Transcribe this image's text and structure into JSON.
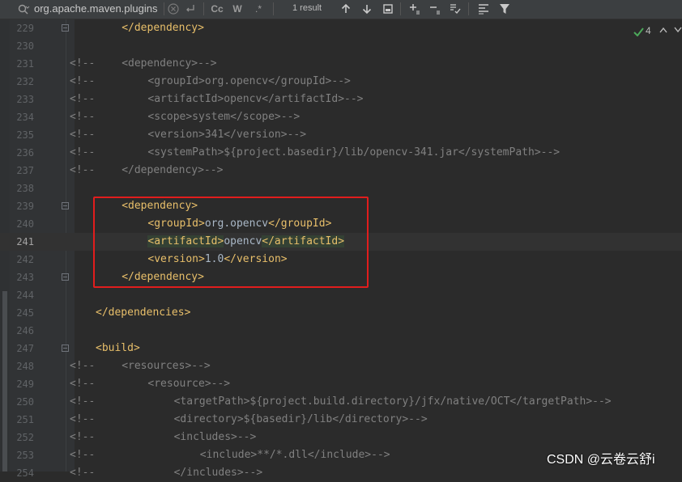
{
  "search": {
    "query": "org.apache.maven.plugins",
    "match_case_label": "Cc",
    "whole_word_label": "W",
    "regex_label": ".*",
    "result_count": "1 result"
  },
  "inspections": {
    "count": "4"
  },
  "editor": {
    "lines": [
      {
        "n": "229",
        "indent": 8,
        "kind": "tag",
        "text": "</dependency>"
      },
      {
        "n": "230",
        "indent": 0,
        "kind": "empty",
        "text": ""
      },
      {
        "n": "231",
        "indent": 0,
        "kind": "comment",
        "prefix": "<!--",
        "pad": 8,
        "text": "<dependency>-->"
      },
      {
        "n": "232",
        "indent": 0,
        "kind": "comment",
        "prefix": "<!--",
        "pad": 12,
        "text": "<groupId>org.opencv</groupId>-->"
      },
      {
        "n": "233",
        "indent": 0,
        "kind": "comment",
        "prefix": "<!--",
        "pad": 12,
        "text": "<artifactId>opencv</artifactId>-->"
      },
      {
        "n": "234",
        "indent": 0,
        "kind": "comment",
        "prefix": "<!--",
        "pad": 12,
        "text": "<scope>system</scope>-->"
      },
      {
        "n": "235",
        "indent": 0,
        "kind": "comment",
        "prefix": "<!--",
        "pad": 12,
        "text": "<version>341</version>-->"
      },
      {
        "n": "236",
        "indent": 0,
        "kind": "comment",
        "prefix": "<!--",
        "pad": 12,
        "text": "<systemPath>${project.basedir}/lib/opencv-341.jar</systemPath>-->"
      },
      {
        "n": "237",
        "indent": 0,
        "kind": "comment",
        "prefix": "<!--",
        "pad": 8,
        "text": "</dependency>-->"
      },
      {
        "n": "238",
        "indent": 0,
        "kind": "empty",
        "text": ""
      },
      {
        "n": "239",
        "indent": 8,
        "kind": "tag",
        "text": "<dependency>"
      },
      {
        "n": "240",
        "indent": 12,
        "kind": "mixed",
        "open": "<groupId>",
        "value": "org.opencv",
        "close": "</groupId>"
      },
      {
        "n": "241",
        "indent": 12,
        "kind": "mixed-hl",
        "open": "<artifactId>",
        "value": "opencv",
        "close": "</artifactId>"
      },
      {
        "n": "242",
        "indent": 12,
        "kind": "mixed",
        "open": "<version>",
        "value": "1.0",
        "close": "</version>"
      },
      {
        "n": "243",
        "indent": 8,
        "kind": "tag",
        "text": "</dependency>"
      },
      {
        "n": "244",
        "indent": 0,
        "kind": "empty",
        "text": ""
      },
      {
        "n": "245",
        "indent": 4,
        "kind": "tag",
        "text": "</dependencies>"
      },
      {
        "n": "246",
        "indent": 0,
        "kind": "empty",
        "text": ""
      },
      {
        "n": "247",
        "indent": 4,
        "kind": "tag",
        "text": "<build>"
      },
      {
        "n": "248",
        "indent": 0,
        "kind": "comment",
        "prefix": "<!--",
        "pad": 8,
        "text": "<resources>-->"
      },
      {
        "n": "249",
        "indent": 0,
        "kind": "comment",
        "prefix": "<!--",
        "pad": 12,
        "text": "<resource>-->"
      },
      {
        "n": "250",
        "indent": 0,
        "kind": "comment",
        "prefix": "<!--",
        "pad": 16,
        "text": "<targetPath>${project.build.directory}/jfx/native/OCT</targetPath>-->"
      },
      {
        "n": "251",
        "indent": 0,
        "kind": "comment",
        "prefix": "<!--",
        "pad": 16,
        "text": "<directory>${basedir}/lib</directory>-->"
      },
      {
        "n": "252",
        "indent": 0,
        "kind": "comment",
        "prefix": "<!--",
        "pad": 16,
        "text": "<includes>-->"
      },
      {
        "n": "253",
        "indent": 0,
        "kind": "comment",
        "prefix": "<!--",
        "pad": 20,
        "text": "<include>**/*.dll</include>-->"
      },
      {
        "n": "254",
        "indent": 0,
        "kind": "comment",
        "prefix": "<!--",
        "pad": 16,
        "text": "</includes>-->"
      }
    ]
  },
  "watermark": "CSDN @云卷云舒i",
  "colors": {
    "background": "#2b2b2b",
    "tag": "#e8bf6a",
    "comment": "#808080",
    "text": "#a9b7c6",
    "highlight_box": "#e11d1d"
  }
}
